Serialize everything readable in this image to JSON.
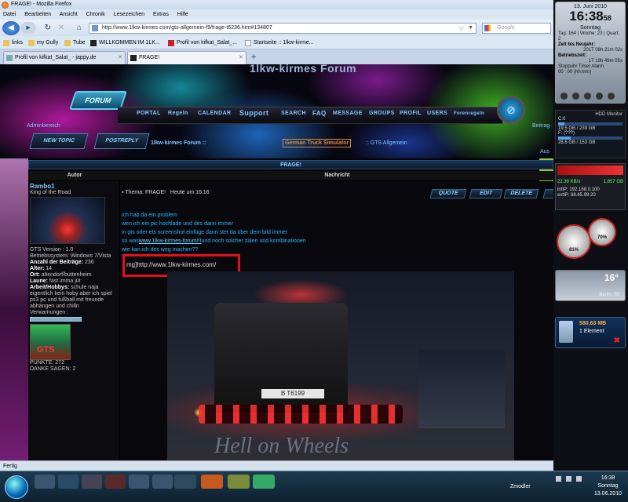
{
  "window": {
    "title": "FRAGE! - Mozilla Firefox"
  },
  "menu": [
    "Datei",
    "Bearbeiten",
    "Ansicht",
    "Chronik",
    "Lesezeichen",
    "Extras",
    "Hilfe"
  ],
  "nav": {
    "url": "http://www.1lkw-kirmes.com/gts-allgemein-f9/frage-t6236.htm#134807",
    "search_placeholder": "Google"
  },
  "bookmarks": [
    "links",
    "my Gully",
    "Tube",
    "WILLKOMMEN IM 1LK...",
    "Profil von kifkat_Salat_...",
    "Startseite :: 1lkw-kirme..."
  ],
  "tabs": [
    {
      "label": "Profil von kifkat_Salat_ - jappy.de",
      "active": false
    },
    {
      "label": "FRAGE!",
      "active": true
    }
  ],
  "forum": {
    "site_title": "1lkw-kirmes Forum",
    "logo": "FORUM",
    "nav_items": [
      "PORTAL",
      "Regeln",
      "CALENDAR",
      "Support",
      "SEARCH",
      "FAQ",
      "MESSAGE",
      "GROUPS",
      "PROFIL",
      "USERS",
      "Forenregeln"
    ],
    "adminbereich": "Adminbereich",
    "beitrag": "Beitrag",
    "new_topic": "NEW TOPIC",
    "postreply": "POSTREPLY",
    "breadcrumb_forum": "1lkw-kirmes Forum  ::",
    "breadcrumb_category": "German Truck Simulator",
    "breadcrumb_sub": "::  GTS Allgemein",
    "aus": "Aus",
    "topic_title": "FRAGE!",
    "col_autor": "Autor",
    "col_nachricht": "Nachricht"
  },
  "author": {
    "name": "Rambo1",
    "rank": "King of the Road",
    "gts_version": "GTS Version : 1.0",
    "os": "Betriebssystem: Windows 7/Vista",
    "posts_label": "Anzahl der Beiträge:",
    "posts": "236",
    "age_label": "Alter:",
    "age": "14",
    "location_label": "Ort:",
    "location": "altendorf/buttenheim",
    "mood_label": "Laune:",
    "mood": "fast imma jüt",
    "hobbies_label": "Arbeit/Hobbys:",
    "hobbies": "schule naja eigentlich kein hoby aber ich spiel ps3 pc und fußball mit freunde abhängen und chilln",
    "warnings_label": "Verwarnungen :",
    "badge": "GTS",
    "punkte": "PUNKTE: 272",
    "danke": "DANKE SAGEN: 2"
  },
  "post": {
    "subject_label": "Thema: FRAGE!",
    "time": "Heute um 16:16",
    "buttons": [
      "QUOTE",
      "EDIT",
      "DELETE"
    ],
    "lines": [
      "ich hab da ein problem",
      "wen ich ein pic hochlade und des dann immer",
      "in gts oder ets screenshot einfüge dann stet da über dem bild immer"
    ],
    "line4_pre": "so was",
    "line4_link": "www.1lkw-kirmes-forum!!!",
    "line4_post": "und noch solcher zalen und kombinationen",
    "line5": "wie kan ich des weg machen??",
    "code": "mg]http://www.1lkw-kirmes.com/",
    "image_caption": "Hell on Wheels",
    "plate": "B T6199"
  },
  "statusbar": {
    "text": "Fertig"
  },
  "gadgets": {
    "clock": {
      "date": "13. Juni 2010",
      "time": "16:38",
      "seconds": "58",
      "day": "Sonntag",
      "info1": "Tag: 164 | Woche: 23 | Quart: 2",
      "info2_label": "Zeit bis Neujahr:",
      "info2": "201T 08h 21m 02s",
      "info3_label": "Betriebszeit:",
      "info3": "1T 19h 49m 05s",
      "info4": "Stoppuhr  Timer  Alarm",
      "info5": "00 : 00 (hh:mm)"
    },
    "hdd": {
      "title": "HDD Monitor",
      "c": "C:0",
      "c_size": "19.5 GB / 239 GB",
      "f": "F: (???)",
      "f_size": "28.6 GB / 153 GB"
    },
    "net": {
      "down": "22.39 KB/s",
      "up": "1.857 GB",
      "intip": "intIP: 192.168.0.100",
      "extip": "extIP: 88.65.99.20"
    },
    "meters": {
      "cpu": "81%",
      "ram": "70%"
    },
    "weather": {
      "temp": "16°",
      "city": "Berlin, BE"
    },
    "bin": {
      "size": "580,63 MB",
      "count": "1 Element"
    }
  },
  "taskbar": {
    "user": "Zmodler",
    "time": "16:38",
    "day": "Sonntag",
    "date": "13.06.2010"
  }
}
